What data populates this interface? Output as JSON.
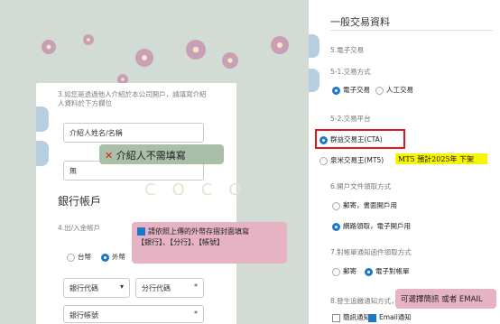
{
  "left_form": {
    "referral_question": "3.如您是透過他人介紹於本公司開戶，請填寫介紹人資料於下方欄位",
    "referrer_name_placeholder": "介紹人姓名/名稱",
    "referrer_select_value": "無",
    "bank_section_title": "銀行帳戶",
    "deposit_question": "4.出/入金帳戶",
    "deposit_opt_domestic": "台幣",
    "deposit_opt_foreign": "外幣",
    "bank_code_label": "銀行代碼",
    "branch_code_label": "分行代碼",
    "account_label": "銀行帳號",
    "required_mark": "*"
  },
  "callouts": {
    "no_referrer": "介紹人不需填寫",
    "bank_note_line1": "請依照上傳的外幣存摺封面填寫",
    "bank_note_line2": "【銀行】、【分行】、【帳號】",
    "notify_note": "可選擇簡訊 或者 EMAIL",
    "mt5_note": "MT5 預計2025年 下架"
  },
  "right_panel": {
    "title": "一般交易資料",
    "sec5_title": "5.電子交易",
    "sec5_1": "5-1.交易方式",
    "opt_electronic": "電子交易",
    "opt_manual": "人工交易",
    "sec5_2": "5-2.交易平台",
    "opt_cta": "群益交易王(CTA)",
    "opt_mt5": "泉米交易王(MT5)",
    "sec6": "6.開戶文件領取方式",
    "opt_mail_book": "郵寄，書面開戶用",
    "opt_online": "網路領取，電子開戶用",
    "sec7": "7.對帳單通知函件領取方式",
    "opt_post": "郵寄",
    "opt_e_statement": "電子對帳單",
    "sec8": "8.發生追繳通知方式，可",
    "opt_sms": "簡訊通知",
    "opt_email": "Email通知"
  },
  "watermark_text": "COCO",
  "colors": {
    "accent": "#1e78c8",
    "highlight_yellow": "#f7f500",
    "callout_pink": "#e6b3c4",
    "callout_gray": "#a9bfa8",
    "red_box": "#e01818"
  }
}
